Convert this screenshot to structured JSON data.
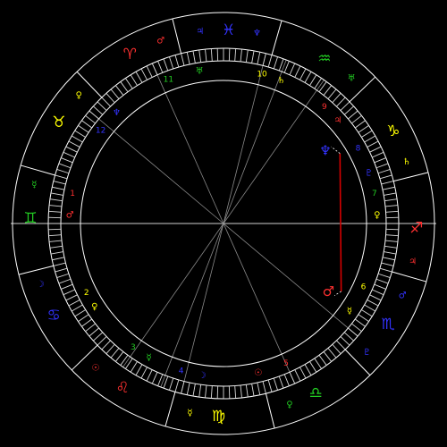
{
  "colors": {
    "background": "#000000",
    "ring": "#ffffff",
    "fire": "#ff3030",
    "earth": "#ffff00",
    "air": "#22cc22",
    "water": "#3333ff",
    "aspect_square": "#d40000"
  },
  "signs": [
    {
      "name": "Aries",
      "glyph": "♈",
      "color": "#ff3030",
      "angle": 119,
      "rulers": [
        {
          "glyph": "♂",
          "color": "#ff3030",
          "angle": 109
        }
      ]
    },
    {
      "name": "Taurus",
      "glyph": "♉",
      "color": "#ffff00",
      "angle": 148.5,
      "rulers": [
        {
          "glyph": "♀",
          "color": "#ffff00",
          "angle": 138.5
        }
      ]
    },
    {
      "name": "Gemini",
      "glyph": "♊",
      "color": "#22cc22",
      "angle": 178.5,
      "rulers": [
        {
          "glyph": "☿",
          "color": "#22cc22",
          "angle": 168.5
        }
      ]
    },
    {
      "name": "Cancer",
      "glyph": "♋",
      "color": "#3333ff",
      "angle": 208.5,
      "rulers": [
        {
          "glyph": "☽",
          "color": "#3333ff",
          "angle": 198.5
        }
      ]
    },
    {
      "name": "Leo",
      "glyph": "♌",
      "color": "#ff3030",
      "angle": 238.5,
      "rulers": [
        {
          "glyph": "☉",
          "color": "#ff3030",
          "angle": 228.5
        }
      ]
    },
    {
      "name": "Virgo",
      "glyph": "♍",
      "color": "#ffff00",
      "angle": 268.5,
      "rulers": [
        {
          "glyph": "☿",
          "color": "#ffff00",
          "angle": 260
        }
      ]
    },
    {
      "name": "Libra",
      "glyph": "♎",
      "color": "#22cc22",
      "angle": 298.5,
      "rulers": [
        {
          "glyph": "♀",
          "color": "#22cc22",
          "angle": 290
        }
      ]
    },
    {
      "name": "Scorpio",
      "glyph": "♏",
      "color": "#3333ff",
      "angle": 328.5,
      "rulers": [
        {
          "glyph": "♇",
          "color": "#3333ff",
          "angle": 318
        },
        {
          "glyph": "♂",
          "color": "#3333ff",
          "angle": 338
        }
      ]
    },
    {
      "name": "Sagittarius",
      "glyph": "♐",
      "color": "#ff3030",
      "angle": 358.5,
      "rulers": [
        {
          "glyph": "♃",
          "color": "#ff3030",
          "angle": 348.5
        }
      ]
    },
    {
      "name": "Capricorn",
      "glyph": "♑",
      "color": "#ffff00",
      "angle": 28.5,
      "rulers": [
        {
          "glyph": "♄",
          "color": "#ffff00",
          "angle": 18.5
        }
      ]
    },
    {
      "name": "Aquarius",
      "glyph": "♒",
      "color": "#22cc22",
      "angle": 58.5,
      "rulers": [
        {
          "glyph": "♅",
          "color": "#22cc22",
          "angle": 48.5
        }
      ]
    },
    {
      "name": "Pisces",
      "glyph": "♓",
      "color": "#3333ff",
      "angle": 88.5,
      "rulers": [
        {
          "glyph": "♆",
          "color": "#3333ff",
          "angle": 80
        },
        {
          "glyph": "♃",
          "color": "#3333ff",
          "angle": 97
        }
      ]
    }
  ],
  "sign_cusps": [
    14,
    44,
    74,
    104,
    134,
    164,
    194,
    224,
    254,
    284,
    314,
    344
  ],
  "houses": [
    {
      "number": "1",
      "color": "#ff3030",
      "angle": 169,
      "ruler": {
        "glyph": "♂",
        "color": "#ff3030",
        "angle": 177
      }
    },
    {
      "number": "2",
      "color": "#ffff00",
      "angle": 207,
      "ruler": {
        "glyph": "♀",
        "color": "#ffff00",
        "angle": 213
      }
    },
    {
      "number": "3",
      "color": "#22cc22",
      "angle": 234,
      "ruler": {
        "glyph": "☿",
        "color": "#22cc22",
        "angle": 241
      }
    },
    {
      "number": "4",
      "color": "#3333ff",
      "angle": 254,
      "ruler": {
        "glyph": "☽",
        "color": "#3333ff",
        "angle": 262
      }
    },
    {
      "number": "5",
      "color": "#ff3030",
      "angle": 294,
      "ruler": {
        "glyph": "☉",
        "color": "#ff3030",
        "angle": 283
      }
    },
    {
      "number": "6",
      "color": "#ffff00",
      "angle": 335.5,
      "ruler": {
        "glyph": "☿",
        "color": "#ffff00",
        "angle": 325
      }
    },
    {
      "number": "7",
      "color": "#22cc22",
      "angle": 11,
      "ruler": {
        "glyph": "♀",
        "color": "#ffff00",
        "angle": 3
      }
    },
    {
      "number": "8",
      "color": "#3333ff",
      "angle": 29,
      "ruler": {
        "glyph": "♇",
        "color": "#3333ff",
        "angle": 19
      }
    },
    {
      "number": "9",
      "color": "#ff3030",
      "angle": 49,
      "ruler": {
        "glyph": "♃",
        "color": "#ff3030",
        "angle": 42
      }
    },
    {
      "number": "10",
      "color": "#ffff00",
      "angle": 75.5,
      "ruler": {
        "glyph": "♄",
        "color": "#ffff00",
        "angle": 68
      }
    },
    {
      "number": "11",
      "color": "#22cc22",
      "angle": 111,
      "ruler": {
        "glyph": "♅",
        "color": "#22cc22",
        "angle": 99
      }
    },
    {
      "number": "12",
      "color": "#3333ff",
      "angle": 143,
      "ruler": {
        "glyph": "♆",
        "color": "#3333ff",
        "angle": 134
      }
    }
  ],
  "house_cusps": [
    180,
    235,
    249,
    256,
    294,
    320,
    0,
    55,
    69,
    76,
    114,
    140
  ],
  "planets": [
    {
      "name": "Neptune",
      "glyph": "♆",
      "color": "#3333ff",
      "angle": 35.5,
      "marker_angle": 31
    },
    {
      "name": "Mars",
      "glyph": "♂",
      "color": "#ff3030",
      "angle": 327,
      "marker_angle": 330
    }
  ],
  "aspects": [
    {
      "type": "square",
      "from": 31,
      "to": 330,
      "color": "#d40000"
    }
  ]
}
